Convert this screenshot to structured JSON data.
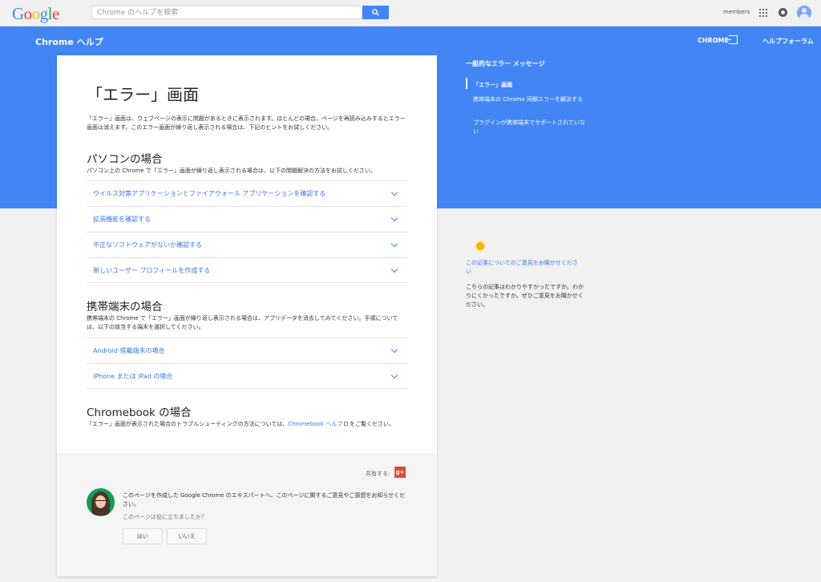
{
  "header": {
    "logo": "Google",
    "search_placeholder": "Chrome のヘルプを検索",
    "members": "members"
  },
  "band": {
    "product_title": "Chrome ヘルプ",
    "chrome_link": "CHROME",
    "forum_link": "ヘルプフォーラム"
  },
  "article": {
    "title": "「エラー」画面",
    "intro": "「エラー」画面は、ウェブページの表示に問題があるときに表示されます。ほとんどの場合、ページを再読み込みするとエラー画面は消えます。このエラー画面が繰り返し表示される場合は、下記のヒントをお試しください。",
    "pc": {
      "heading": "パソコンの場合",
      "desc": "パソコン上の Chrome で「エラー」画面が繰り返し表示される場合は、以下の問題解決の方法をお試しください。",
      "items": [
        "ウイルス対策アプリケーションとファイアウォール アプリケーションを確認する",
        "拡張機能を確認する",
        "不正なソフトウェアがないか確認する",
        "新しいユーザー プロフィールを作成する"
      ]
    },
    "mobile": {
      "heading": "携帯端末の場合",
      "desc": "携帯端末の Chrome で「エラー」画面が繰り返し表示される場合は、アプリデータを消去してみてください。手順については、以下の該当する端末を選択してください。",
      "items": [
        "Android 搭載端末の場合",
        "iPhone または iPad の場合"
      ]
    },
    "chromebook": {
      "heading": "Chromebook の場合",
      "desc_before": "「エラー」画面が表示された場合のトラブルシューティングの方法については、",
      "desc_link": "Chromebook ヘルプ",
      "desc_after": "をご覧ください。"
    }
  },
  "feedback": {
    "share_label": "共有する:",
    "gplus": "g+",
    "expert_text": "このページを作成した Google Chrome のエキスパートへ、このページに関するご意見やご感想をお知らせください。",
    "expert_note": "このページは役に立ちましたか？",
    "yes": "はい",
    "no": "いいえ"
  },
  "sidebar": {
    "toc_title": "一般的なエラー メッセージ",
    "toc_items": [
      "「エラー」画面",
      "携帯端末の Chrome 同期エラーを解決する",
      "プラグインが携帯端末でサポートされていない"
    ],
    "fb_head": "この記事についてのご意見をお聞かせください",
    "fb_body": "こちらの記事はわかりやすかったですか。わかりにくかったですか。ぜひご意見をお聞かせください。"
  },
  "colors": {
    "brand_blue": "#4285f4",
    "link_blue": "#3b78e7",
    "gplus_red": "#dd4b39",
    "bulb_yellow": "#f4b400"
  }
}
